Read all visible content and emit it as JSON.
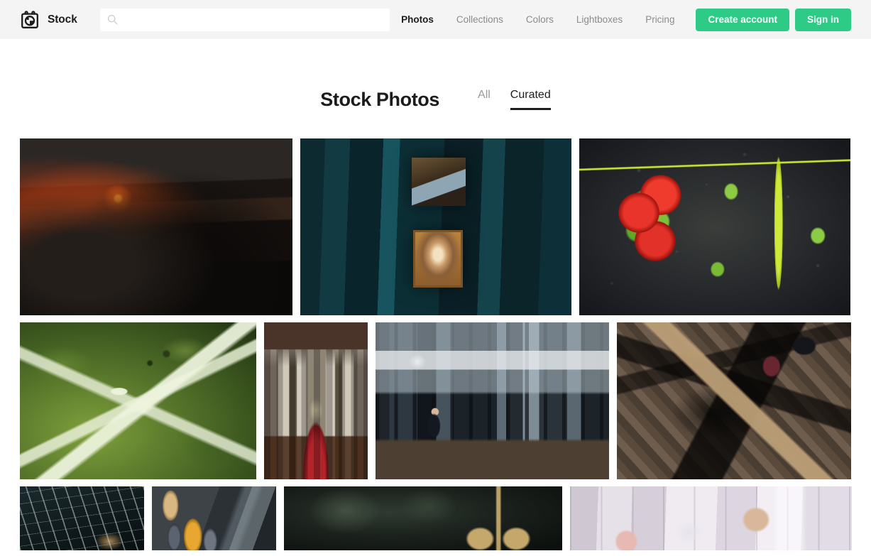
{
  "header": {
    "brand_name": "Stock",
    "logo_icon": "camera-aperture-icon",
    "search": {
      "icon": "search-icon",
      "value": "",
      "placeholder": ""
    },
    "nav_links": [
      {
        "label": "Photos",
        "active": true
      },
      {
        "label": "Collections",
        "active": false
      },
      {
        "label": "Colors",
        "active": false
      },
      {
        "label": "Lightboxes",
        "active": false
      },
      {
        "label": "Pricing",
        "active": false
      }
    ],
    "create_account_label": "Create account",
    "sign_in_label": "Sign in"
  },
  "main": {
    "page_title": "Stock Photos",
    "tabs": [
      {
        "label": "All",
        "active": false
      },
      {
        "label": "Curated",
        "active": true
      }
    ]
  },
  "gallery": {
    "rows": [
      {
        "items": [
          {
            "name": "photo-welder",
            "alt": "Welder working under a vehicle with orange sparks"
          },
          {
            "name": "photo-antique-shop",
            "alt": "Teal antique shop interior with framed picture"
          },
          {
            "name": "photo-tomatoes-basil",
            "alt": "Tomatoes, basil leaves and a lime knife on dark stone"
          }
        ]
      },
      {
        "items": [
          {
            "name": "photo-moth",
            "alt": "White plume moth on green bokeh background"
          },
          {
            "name": "photo-church-nave",
            "alt": "Church nave interior with red carpet aisle"
          },
          {
            "name": "photo-loft-interior",
            "alt": "Person seated in a loft cafe with tall windows"
          },
          {
            "name": "photo-shoes-wood-floor",
            "alt": "Leather shoes on dark herringbone wooden floor"
          }
        ]
      },
      {
        "items": [
          {
            "name": "photo-scaffolding",
            "alt": "Metal scaffolding structure at night"
          },
          {
            "name": "photo-wall-plates",
            "alt": "Decorative plates mounted on a grey wall"
          },
          {
            "name": "photo-sunglasses",
            "alt": "Aviator sunglasses on a dark blurred background"
          },
          {
            "name": "photo-retail-shelving",
            "alt": "White retail shelving displaying shoes and bags"
          }
        ]
      }
    ]
  },
  "colors": {
    "accent_green": "#2ecb87",
    "header_background": "#f4f4f4",
    "text_primary": "#1c1c1c",
    "text_muted": "#8b8b8b",
    "page_background": "#ffffff"
  }
}
